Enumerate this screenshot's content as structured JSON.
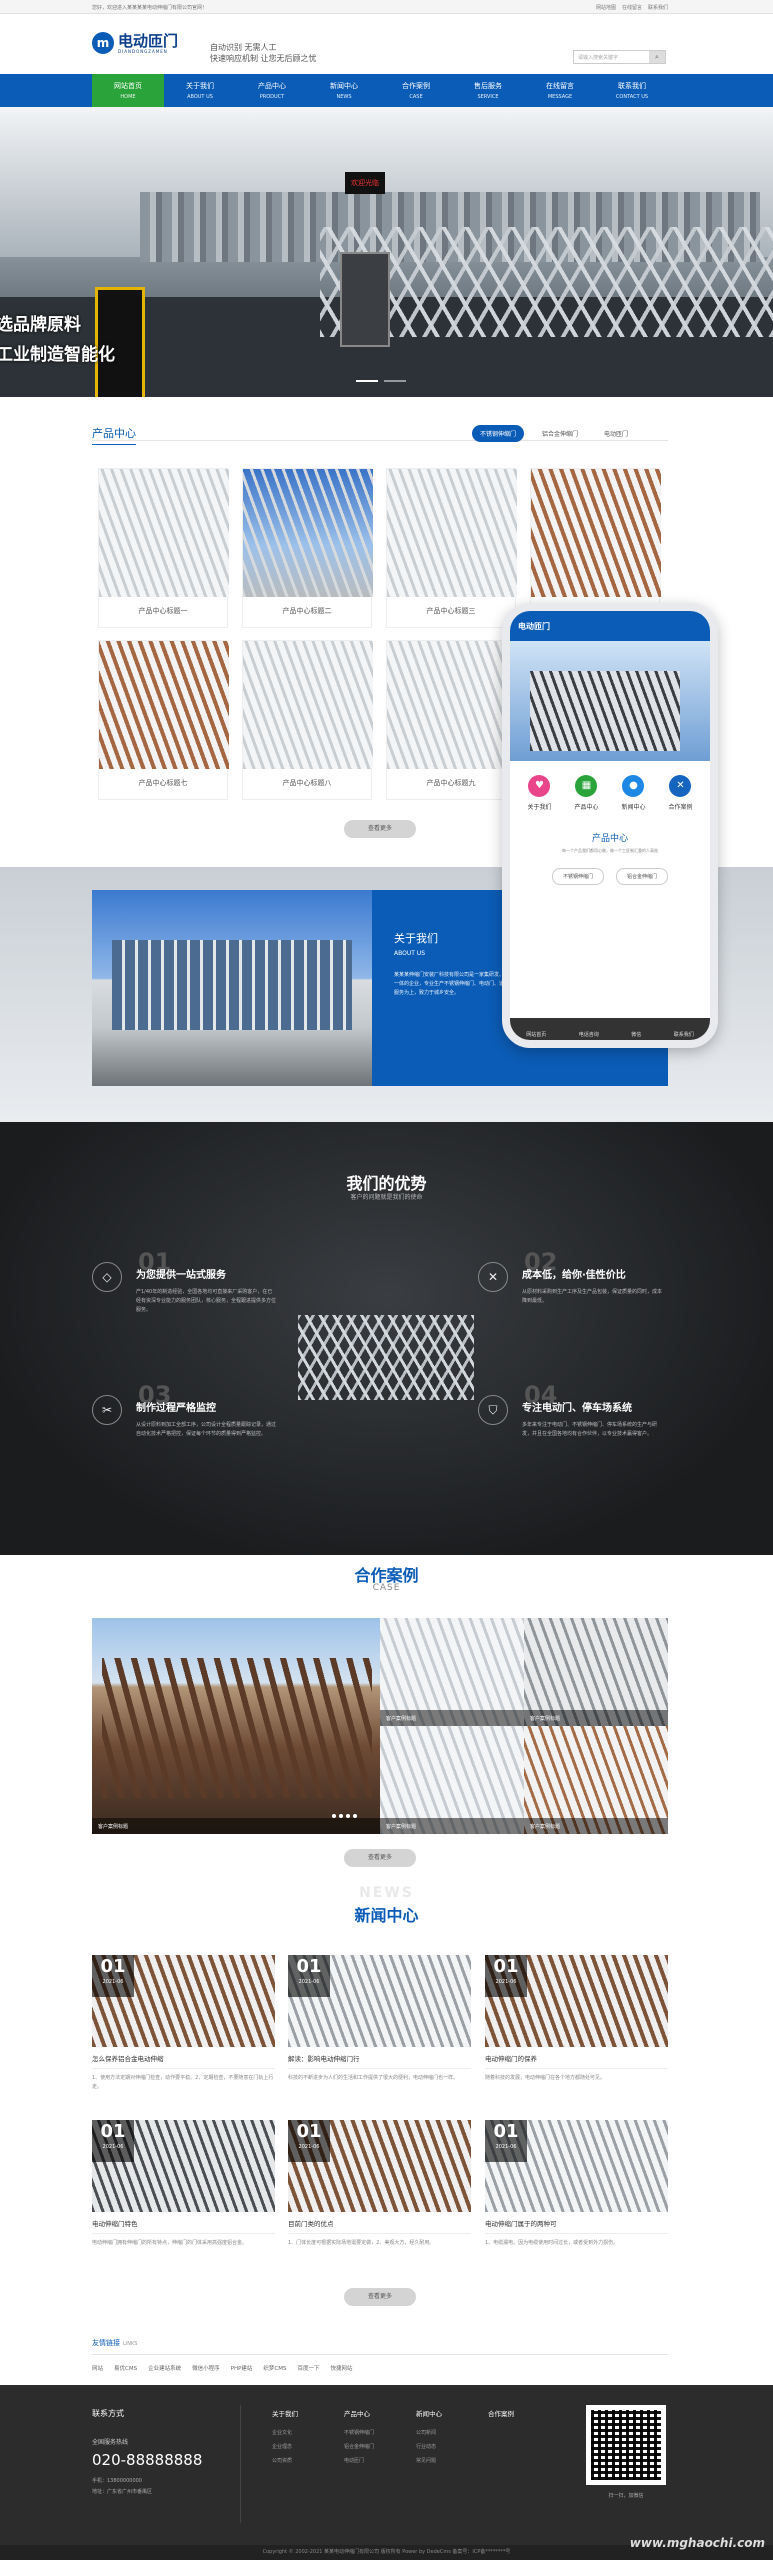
{
  "topbar": {
    "welcome": "您好，欢迎进入某某某某电动伸缩门有限公司官网！",
    "links": [
      "网站地图",
      "在线留言",
      "联系我们"
    ]
  },
  "header": {
    "logo_mark": "m",
    "logo_title": "电动匝门",
    "logo_sub": "DIANDONGZAMEN",
    "slogan1": "自动识别 无需人工",
    "slogan2": "快速响应机制 让您无后顾之忧",
    "search_placeholder": "请输入搜索关键字",
    "search_icon": "search-icon"
  },
  "nav": [
    {
      "zh": "网站首页",
      "en": "HOME"
    },
    {
      "zh": "关于我们",
      "en": "ABOUT US"
    },
    {
      "zh": "产品中心",
      "en": "PRODUCT"
    },
    {
      "zh": "新闻中心",
      "en": "NEWS"
    },
    {
      "zh": "合作案例",
      "en": "CASE"
    },
    {
      "zh": "售后服务",
      "en": "SERVICE"
    },
    {
      "zh": "在线留言",
      "en": "MESSAGE"
    },
    {
      "zh": "联系我们",
      "en": "CONTACT US"
    }
  ],
  "banner": {
    "slogan1": "选品牌原料",
    "slogan2": "工业制造智能化",
    "sign": "欢迎光临"
  },
  "products": {
    "title": "产品中心",
    "tabs": [
      "不锈钢伸缩门",
      "铝合金伸缩门",
      "电动匝门"
    ],
    "items": [
      "产品中心标题一",
      "产品中心标题二",
      "产品中心标题三",
      "",
      "产品中心标题七",
      "产品中心标题八",
      "产品中心标题九"
    ],
    "more": "查看更多"
  },
  "phone": {
    "title": "电动匝门",
    "icons": [
      "关于我们",
      "产品中心",
      "新闻中心",
      "合作案例"
    ],
    "section": "产品中心",
    "sub": "每一个产品我们都用心做，做一个工匠制汇重的人高效",
    "buttons": [
      "不锈钢伸缩门",
      "铝合金伸缩门"
    ],
    "footer": [
      "网站首页",
      "电话咨询",
      "微信",
      "联系我们"
    ]
  },
  "about": {
    "title": "关于我们",
    "en": "ABOUT US",
    "desc": "某某某伸缩门安装厂科技有限公司是一家集研发、生产、销售和施工及工程承接于一体的企业，专业生产不锈钢伸缩门、电动门、道闸、快速门等产品，质量一流，服务为上，致力于城乡安全。"
  },
  "advantage": {
    "title": "我们的优势",
    "sub": "客户的问题就是我们的使命",
    "items": [
      {
        "num": "01",
        "title": "为您提供一站式服务",
        "desc": "产1/40年的制造经验，全国各地均可直接来厂采购客户，在已经有资深专业能力的服务团队，核心服务，全程跟进提供多方位服务。"
      },
      {
        "num": "02",
        "title": "成本低，给你·佳性价比",
        "desc": "从原材料采购到生产工序及生产品包装，保证质量的同时，成本降到最低。"
      },
      {
        "num": "03",
        "title": "制作过程严格监控",
        "desc": "从设计原料到加工全部工序，公司设计全程质量跟踪记录，通过自动化技术严格把控，保证每个环节的质量得到严格监控。"
      },
      {
        "num": "04",
        "title": "专注电动门、停车场系统",
        "desc": "多年来专注于电动门、不锈钢伸缩门、停车场系统的生产与研发，并且在全国各地均有合作伙伴，以专业技术赢得客户。"
      }
    ]
  },
  "case": {
    "title": "合作案例",
    "en": "CASE",
    "captions": [
      "客户案例标题",
      "客户案例标题",
      "客户案例标题",
      "客户案例标题",
      "客户案例标题"
    ],
    "more": "查看更多"
  },
  "news": {
    "en": "NEWS",
    "title": "新闻中心",
    "items": [
      {
        "day": "01",
        "ym": "2021-06",
        "title": "怎么保养铝合金电动伸缩",
        "desc": "1、使用方法定期对伸缩门检查，动作要平稳。2、定期检查，不要随意在门轨上行走。"
      },
      {
        "day": "01",
        "ym": "2021-06",
        "title": "解读：影响电动伸缩门行",
        "desc": "科技的不断进步为人们的生活和工作提供了很大的便利，电动伸缩门也一样。"
      },
      {
        "day": "01",
        "ym": "2021-06",
        "title": "电动伸缩门的保养",
        "desc": "随着科技的发展，电动伸缩门在各个地方都随处可见。"
      },
      {
        "day": "01",
        "ym": "2021-06",
        "title": "电动伸缩门特色",
        "desc": "电动伸缩门拥有伸缩门的所有特点，伸缩门的门体采用高强度铝合金。"
      },
      {
        "day": "01",
        "ym": "2021-06",
        "title": "目前门类的优点",
        "desc": "1、门体长度可根据实际场地需要定做，2、美观大方，经久耐用。"
      },
      {
        "day": "01",
        "ym": "2021-06",
        "title": "电动伸缩门属于的两种可",
        "desc": "1、电缆漏电。因为电缆使用时间过长，或者受到外力损伤。"
      }
    ],
    "more": "查看更多"
  },
  "links": {
    "title": "友情链接",
    "en": "LINKS",
    "items": [
      "网站",
      "易优CMS",
      "企业建站系统",
      "微信小程序",
      "PHP建站",
      "织梦CMS",
      "百度一下",
      "快捷网站"
    ]
  },
  "footer": {
    "contact_title": "联系方式",
    "hotline_label": "全国服务热线",
    "tel": "020-88888888",
    "phone": "手机：13800000000",
    "address": "地址：广东省广州市番禺区",
    "cols": [
      {
        "title": "关于我们",
        "items": [
          "企业文化",
          "企业理念",
          "公司资质"
        ]
      },
      {
        "title": "产品中心",
        "items": [
          "不锈钢伸缩门",
          "铝合金伸缩门",
          "电动匝门"
        ]
      },
      {
        "title": "新闻中心",
        "items": [
          "公司新闻",
          "行业动态",
          "常见问题"
        ]
      },
      {
        "title": "合作案例",
        "items": []
      }
    ],
    "qr_label": "扫一扫，加微信",
    "copyright": "Copyright © 2002-2021 某某电动伸缩门有限公司 版权所有 Power by DedeCms  备案号：ICP备********号",
    "watermark": "www.mghaochi.com"
  }
}
